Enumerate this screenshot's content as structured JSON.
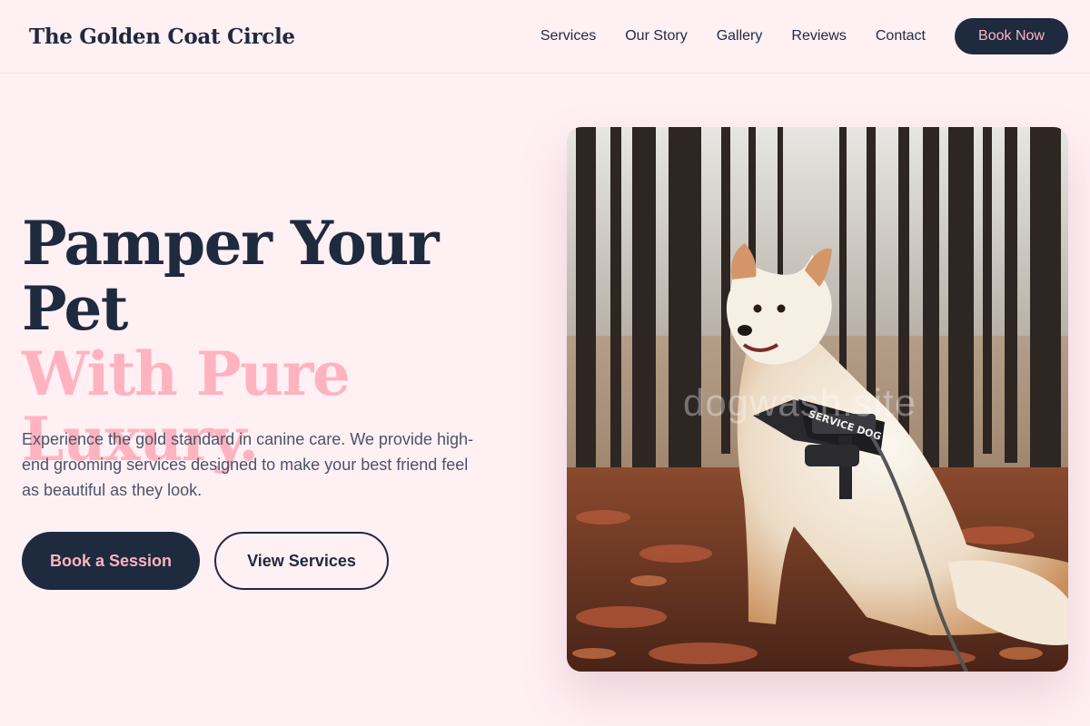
{
  "header": {
    "brand": "The Golden Coat Circle",
    "nav": [
      "Services",
      "Our Story",
      "Gallery",
      "Reviews",
      "Contact"
    ],
    "cta": "Book Now"
  },
  "hero": {
    "title_line1": "Pamper Your Pet",
    "title_line2": "With Pure Luxury.",
    "description": "Experience the gold standard in canine care. We provide high-end grooming services designed to make your best friend feel as beautiful as they look.",
    "primary_button": "Book a Session",
    "secondary_button": "View Services"
  },
  "image": {
    "harness_text": "SERVICE DOG",
    "watermark": "dogwash.site"
  },
  "colors": {
    "background": "#fff0f4",
    "navy": "#1e2a3e",
    "pink": "#ffb3c1"
  }
}
